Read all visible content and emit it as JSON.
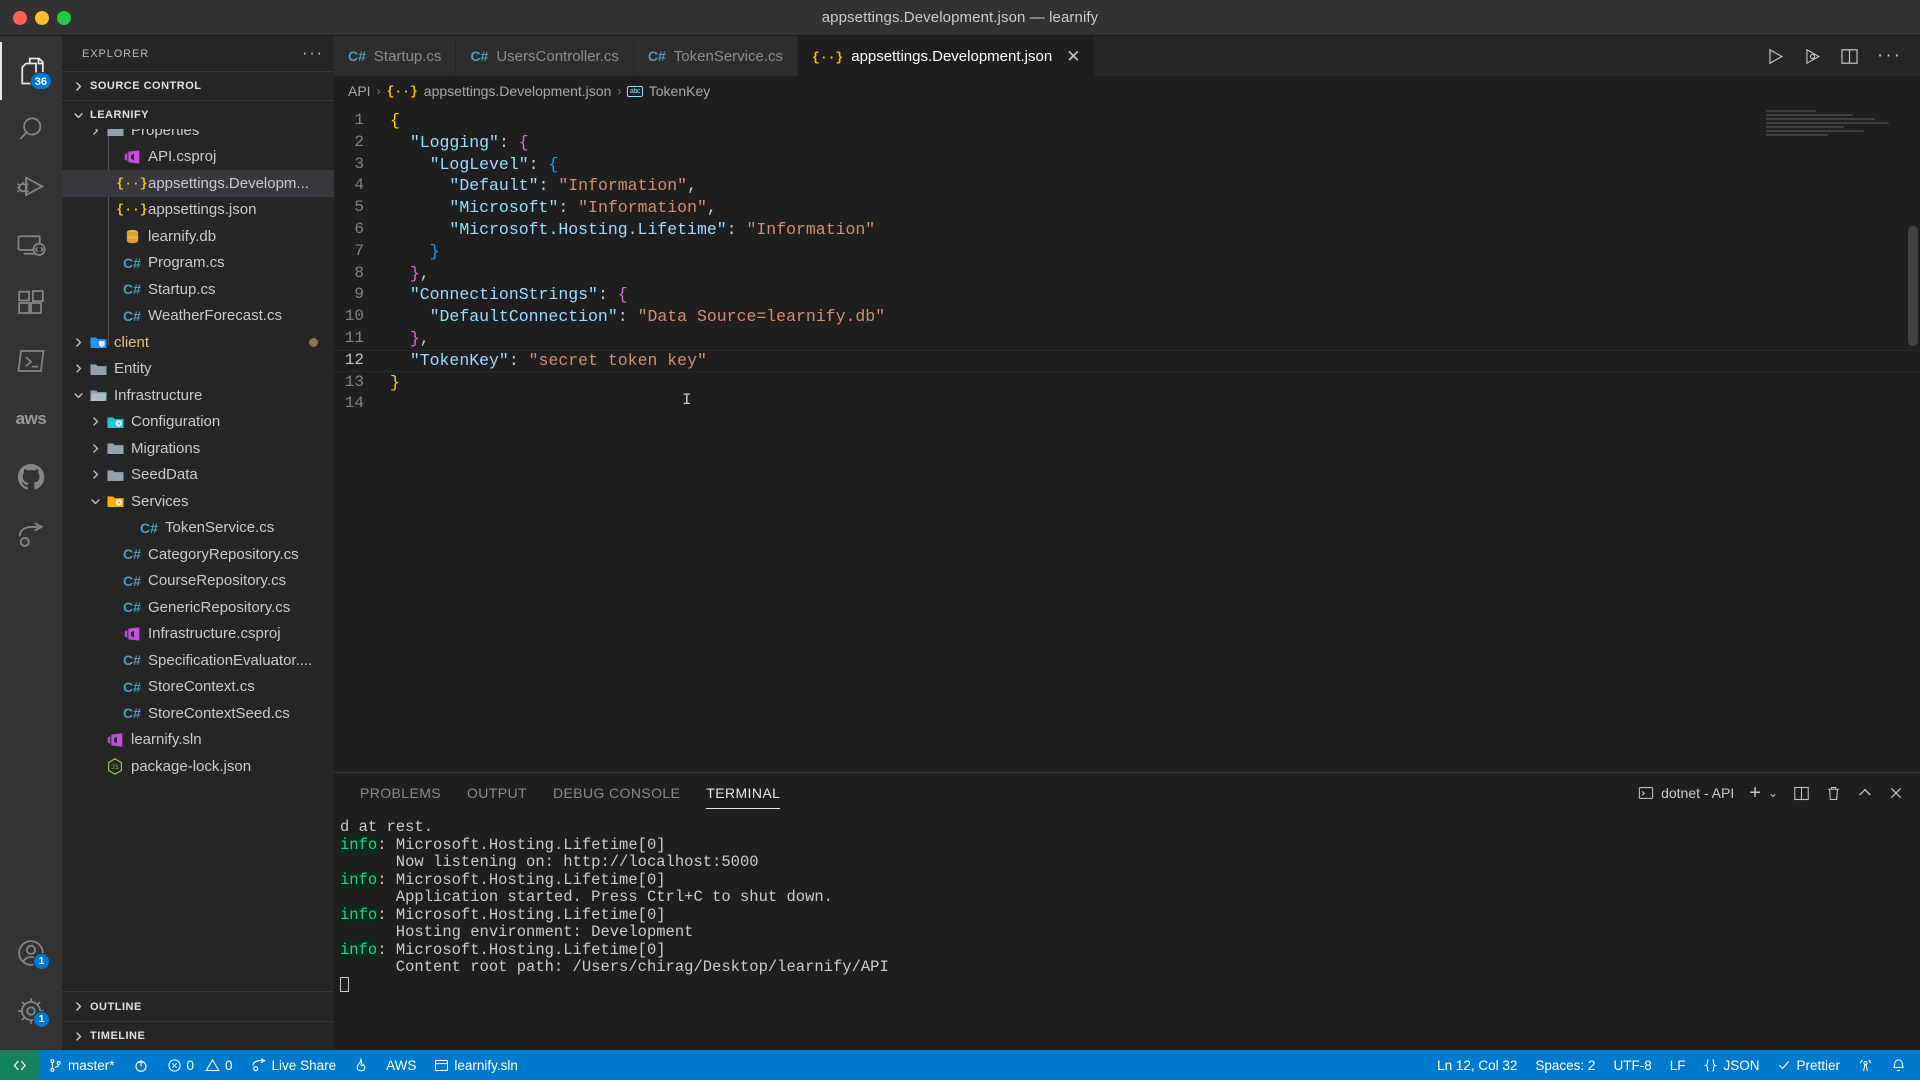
{
  "window": {
    "title": "appsettings.Development.json — learnify",
    "traffic_lights": [
      "close",
      "minimize",
      "maximize"
    ]
  },
  "activitybar": {
    "items": [
      {
        "name": "explorer",
        "icon": "files-icon",
        "badge": "36",
        "active": true
      },
      {
        "name": "search",
        "icon": "search-icon",
        "badge": null,
        "active": false
      },
      {
        "name": "run-and-debug",
        "icon": "run-debug-icon",
        "badge": null,
        "active": false
      },
      {
        "name": "remote-explorer",
        "icon": "remote-icon",
        "badge": null,
        "active": false
      },
      {
        "name": "extensions",
        "icon": "extensions-icon",
        "badge": null,
        "active": false
      },
      {
        "name": "powershell",
        "icon": "terminal-prompt-icon",
        "badge": null,
        "active": false
      },
      {
        "name": "aws-toolkit",
        "icon": "aws-icon",
        "label": "aws",
        "badge": null,
        "active": false
      },
      {
        "name": "github",
        "icon": "github-icon",
        "badge": null,
        "active": false
      },
      {
        "name": "live-share",
        "icon": "live-share-icon",
        "badge": null,
        "active": false
      }
    ],
    "bottom_items": [
      {
        "name": "accounts",
        "icon": "account-icon",
        "badge": "1"
      },
      {
        "name": "manage-settings",
        "icon": "gear-icon",
        "badge": "1"
      }
    ]
  },
  "sidebar": {
    "header_title": "EXPLORER",
    "header_more": "···",
    "sections": [
      {
        "label": "SOURCE CONTROL",
        "expanded": false
      },
      {
        "label": "LEARNIFY",
        "expanded": true
      },
      {
        "label": "OUTLINE",
        "expanded": false
      },
      {
        "label": "TIMELINE",
        "expanded": false
      }
    ],
    "tree": [
      {
        "label": "Properties",
        "icon": "folder-icon",
        "indent": 2,
        "twisty": "collapsed",
        "clipped": true
      },
      {
        "label": "API.csproj",
        "icon": "csproj-icon",
        "indent": 3,
        "twisty": "none"
      },
      {
        "label": "appsettings.Developm...",
        "icon": "json-icon",
        "indent": 3,
        "twisty": "none",
        "selected": true
      },
      {
        "label": "appsettings.json",
        "icon": "json-icon",
        "indent": 3,
        "twisty": "none"
      },
      {
        "label": "learnify.db",
        "icon": "database-icon",
        "indent": 3,
        "twisty": "none"
      },
      {
        "label": "Program.cs",
        "icon": "csharp-icon",
        "indent": 3,
        "twisty": "none"
      },
      {
        "label": "Startup.cs",
        "icon": "csharp-icon",
        "indent": 3,
        "twisty": "none"
      },
      {
        "label": "WeatherForecast.cs",
        "icon": "csharp-icon",
        "indent": 3,
        "twisty": "none"
      },
      {
        "label": "client",
        "icon": "folder-client-icon",
        "indent": 1,
        "twisty": "collapsed",
        "modified": true
      },
      {
        "label": "Entity",
        "icon": "folder-icon",
        "indent": 1,
        "twisty": "collapsed"
      },
      {
        "label": "Infrastructure",
        "icon": "folder-open-icon",
        "indent": 1,
        "twisty": "expanded"
      },
      {
        "label": "Configuration",
        "icon": "folder-config-icon",
        "indent": 2,
        "twisty": "collapsed"
      },
      {
        "label": "Migrations",
        "icon": "folder-icon",
        "indent": 2,
        "twisty": "collapsed"
      },
      {
        "label": "SeedData",
        "icon": "folder-icon",
        "indent": 2,
        "twisty": "collapsed"
      },
      {
        "label": "Services",
        "icon": "folder-services-icon",
        "indent": 2,
        "twisty": "expanded"
      },
      {
        "label": "TokenService.cs",
        "icon": "csharp-icon",
        "indent": 4,
        "twisty": "none"
      },
      {
        "label": "CategoryRepository.cs",
        "icon": "csharp-icon",
        "indent": 3,
        "twisty": "none"
      },
      {
        "label": "CourseRepository.cs",
        "icon": "csharp-icon",
        "indent": 3,
        "twisty": "none"
      },
      {
        "label": "GenericRepository.cs",
        "icon": "csharp-icon",
        "indent": 3,
        "twisty": "none"
      },
      {
        "label": "Infrastructure.csproj",
        "icon": "csproj-icon",
        "indent": 3,
        "twisty": "none"
      },
      {
        "label": "SpecificationEvaluator....",
        "icon": "csharp-icon",
        "indent": 3,
        "twisty": "none"
      },
      {
        "label": "StoreContext.cs",
        "icon": "csharp-icon",
        "indent": 3,
        "twisty": "none"
      },
      {
        "label": "StoreContextSeed.cs",
        "icon": "csharp-icon",
        "indent": 3,
        "twisty": "none"
      },
      {
        "label": "learnify.sln",
        "icon": "csproj-icon",
        "indent": 2,
        "twisty": "none"
      },
      {
        "label": "package-lock.json",
        "icon": "nodejs-icon",
        "indent": 2,
        "twisty": "none"
      }
    ]
  },
  "editor": {
    "tabs": [
      {
        "label": "Startup.cs",
        "icon": "csharp-icon",
        "active": false,
        "closable": false
      },
      {
        "label": "UsersController.cs",
        "icon": "csharp-icon",
        "active": false,
        "closable": false
      },
      {
        "label": "TokenService.cs",
        "icon": "csharp-icon",
        "active": false,
        "closable": false
      },
      {
        "label": "appsettings.Development.json",
        "icon": "json-icon",
        "active": true,
        "closable": true,
        "close_glyph": "✕"
      }
    ],
    "tab_actions": [
      {
        "name": "run-button",
        "glyph": "▷"
      },
      {
        "name": "run-with-debug-button",
        "glyph": "debug"
      },
      {
        "name": "split-editor-button",
        "glyph": "split"
      },
      {
        "name": "more-actions-button",
        "glyph": "···"
      }
    ],
    "breadcrumb": [
      {
        "label": "API",
        "icon": null
      },
      {
        "label": "appsettings.Development.json",
        "icon": "json-icon"
      },
      {
        "label": "TokenKey",
        "icon": "abc-icon"
      }
    ],
    "breadcrumb_separator": "›",
    "active_line": 12,
    "code": [
      {
        "n": 1,
        "segments": [
          {
            "t": "{",
            "c": "brace1"
          }
        ]
      },
      {
        "n": 2,
        "segments": [
          {
            "t": "  ",
            "c": "plain"
          },
          {
            "t": "\"Logging\"",
            "c": "key"
          },
          {
            "t": ": ",
            "c": "punc"
          },
          {
            "t": "{",
            "c": "brace2"
          }
        ]
      },
      {
        "n": 3,
        "segments": [
          {
            "t": "    ",
            "c": "plain"
          },
          {
            "t": "\"LogLevel\"",
            "c": "key"
          },
          {
            "t": ": ",
            "c": "punc"
          },
          {
            "t": "{",
            "c": "brace3"
          }
        ]
      },
      {
        "n": 4,
        "segments": [
          {
            "t": "      ",
            "c": "plain"
          },
          {
            "t": "\"Default\"",
            "c": "key"
          },
          {
            "t": ": ",
            "c": "punc"
          },
          {
            "t": "\"Information\"",
            "c": "str"
          },
          {
            "t": ",",
            "c": "punc"
          }
        ]
      },
      {
        "n": 5,
        "segments": [
          {
            "t": "      ",
            "c": "plain"
          },
          {
            "t": "\"Microsoft\"",
            "c": "key"
          },
          {
            "t": ": ",
            "c": "punc"
          },
          {
            "t": "\"Information\"",
            "c": "str"
          },
          {
            "t": ",",
            "c": "punc"
          }
        ]
      },
      {
        "n": 6,
        "segments": [
          {
            "t": "      ",
            "c": "plain"
          },
          {
            "t": "\"Microsoft.Hosting.Lifetime\"",
            "c": "key"
          },
          {
            "t": ": ",
            "c": "punc"
          },
          {
            "t": "\"Information\"",
            "c": "str"
          }
        ]
      },
      {
        "n": 7,
        "segments": [
          {
            "t": "    ",
            "c": "plain"
          },
          {
            "t": "}",
            "c": "brace3"
          }
        ]
      },
      {
        "n": 8,
        "segments": [
          {
            "t": "  ",
            "c": "plain"
          },
          {
            "t": "}",
            "c": "brace2"
          },
          {
            "t": ",",
            "c": "punc"
          }
        ]
      },
      {
        "n": 9,
        "segments": [
          {
            "t": "  ",
            "c": "plain"
          },
          {
            "t": "\"ConnectionStrings\"",
            "c": "key"
          },
          {
            "t": ": ",
            "c": "punc"
          },
          {
            "t": "{",
            "c": "brace2"
          }
        ]
      },
      {
        "n": 10,
        "segments": [
          {
            "t": "    ",
            "c": "plain"
          },
          {
            "t": "\"DefaultConnection\"",
            "c": "key"
          },
          {
            "t": ": ",
            "c": "punc"
          },
          {
            "t": "\"Data Source=learnify.db\"",
            "c": "str"
          }
        ]
      },
      {
        "n": 11,
        "segments": [
          {
            "t": "  ",
            "c": "plain"
          },
          {
            "t": "}",
            "c": "brace2"
          },
          {
            "t": ",",
            "c": "punc"
          }
        ]
      },
      {
        "n": 12,
        "segments": [
          {
            "t": "  ",
            "c": "plain"
          },
          {
            "t": "\"TokenKey\"",
            "c": "key"
          },
          {
            "t": ": ",
            "c": "punc"
          },
          {
            "t": "\"secret token key\"",
            "c": "str"
          }
        ]
      },
      {
        "n": 13,
        "segments": [
          {
            "t": "}",
            "c": "brace1"
          }
        ]
      },
      {
        "n": 14,
        "segments": [
          {
            "t": "",
            "c": "plain"
          }
        ]
      }
    ]
  },
  "panel": {
    "tabs": [
      {
        "label": "PROBLEMS",
        "active": false
      },
      {
        "label": "OUTPUT",
        "active": false
      },
      {
        "label": "DEBUG CONSOLE",
        "active": false
      },
      {
        "label": "TERMINAL",
        "active": true
      }
    ],
    "terminal_selector": "dotnet - API",
    "actions": [
      {
        "name": "new-terminal-button",
        "glyph": "+"
      },
      {
        "name": "terminal-dropdown-button",
        "glyph": "⌄"
      },
      {
        "name": "split-terminal-button",
        "glyph": "split"
      },
      {
        "name": "kill-terminal-button",
        "glyph": "trash"
      },
      {
        "name": "maximize-panel-button",
        "glyph": "⌃"
      },
      {
        "name": "close-panel-button",
        "glyph": "✕"
      }
    ],
    "terminal_lines": [
      {
        "prefix": null,
        "text": "d at rest."
      },
      {
        "prefix": "info",
        "text": ": Microsoft.Hosting.Lifetime[0]"
      },
      {
        "prefix": null,
        "text": "      Now listening on: http://localhost:5000"
      },
      {
        "prefix": "info",
        "text": ": Microsoft.Hosting.Lifetime[0]"
      },
      {
        "prefix": null,
        "text": "      Application started. Press Ctrl+C to shut down."
      },
      {
        "prefix": "info",
        "text": ": Microsoft.Hosting.Lifetime[0]"
      },
      {
        "prefix": null,
        "text": "      Hosting environment: Development"
      },
      {
        "prefix": "info",
        "text": ": Microsoft.Hosting.Lifetime[0]"
      },
      {
        "prefix": null,
        "text": "      Content root path: /Users/chirag/Desktop/learnify/API"
      },
      {
        "prefix": null,
        "text": "",
        "cursor": true
      }
    ]
  },
  "statusbar": {
    "remote_icon": "remote-indicator-icon",
    "left_items": [
      {
        "name": "branch",
        "icon": "source-control-icon",
        "label": "master*"
      },
      {
        "name": "sync",
        "icon": "sync-icon",
        "label": ""
      },
      {
        "name": "problems",
        "icon": "errors-warnings-icon",
        "label": "0",
        "label2": "0"
      },
      {
        "name": "live-share",
        "icon": "live-share-icon",
        "label": "Live Share"
      },
      {
        "name": "flame",
        "icon": "flame-icon",
        "label": ""
      },
      {
        "name": "aws",
        "icon": null,
        "label": "AWS"
      },
      {
        "name": "solution",
        "icon": "window-icon",
        "label": "learnify.sln"
      }
    ],
    "right_items": [
      {
        "name": "cursor-position",
        "label": "Ln 12, Col 32"
      },
      {
        "name": "indentation",
        "label": "Spaces: 2"
      },
      {
        "name": "encoding",
        "label": "UTF-8"
      },
      {
        "name": "eol",
        "label": "LF"
      },
      {
        "name": "language-mode",
        "label": "JSON",
        "icon": "json-braces-icon"
      },
      {
        "name": "prettier",
        "label": "Prettier",
        "icon": "check-icon"
      },
      {
        "name": "remote-status",
        "icon": "broadcast-icon",
        "label": ""
      },
      {
        "name": "notifications",
        "icon": "bell-icon",
        "label": ""
      }
    ],
    "colors": {
      "accent": "#007acc",
      "remote": "#16825d"
    }
  }
}
